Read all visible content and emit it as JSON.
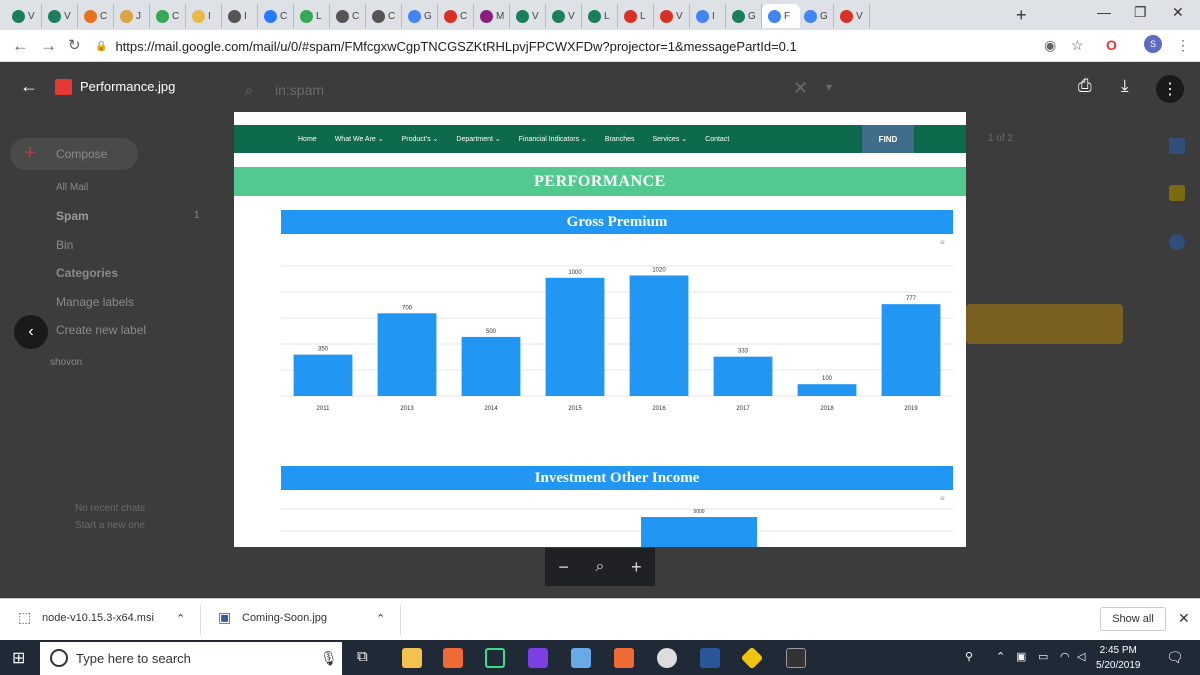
{
  "browser": {
    "tabs": [
      {
        "label": "V"
      },
      {
        "label": "V"
      },
      {
        "label": "C"
      },
      {
        "label": "J"
      },
      {
        "label": "C"
      },
      {
        "label": "I"
      },
      {
        "label": "I"
      },
      {
        "label": "C"
      },
      {
        "label": "L"
      },
      {
        "label": "C"
      },
      {
        "label": "C"
      },
      {
        "label": "G"
      },
      {
        "label": "C"
      },
      {
        "label": "M"
      },
      {
        "label": "V"
      },
      {
        "label": "V"
      },
      {
        "label": "L"
      },
      {
        "label": "L"
      },
      {
        "label": "V"
      },
      {
        "label": "I"
      },
      {
        "label": "G"
      },
      {
        "label": "F"
      },
      {
        "label": "G"
      },
      {
        "label": "V"
      }
    ],
    "active_tab_label": "F",
    "url": "https://mail.google.com/mail/u/0/#spam/FMfcgxwCgpTNCGSZKtRHLpvjFPCWXFDw?projector=1&messagePartId=0.1",
    "profile_initial": "S"
  },
  "gmail": {
    "search_value": "in:spam",
    "compose_label": "Compose",
    "all_mail_label": "All Mail",
    "spam_label": "Spam",
    "spam_count": "1",
    "bin_label": "Bin",
    "categories_label": "Categories",
    "manage_labels": "Manage labels",
    "create_label": "Create new label",
    "user_name": "shovon",
    "no_chats": "No recent chats",
    "start_chat": "Start a new one",
    "pagination": "1 of 2"
  },
  "viewer": {
    "filename": "Performance.jpg"
  },
  "site": {
    "nav": [
      "Home",
      "What We Are ⌄",
      "Product's ⌄",
      "Department ⌄",
      "Financial Indicators ⌄",
      "Branches",
      "Services ⌄",
      "Contact"
    ],
    "find_label": "FIND",
    "section_title": "PERFORMANCE"
  },
  "chart_data": [
    {
      "type": "bar",
      "title": "Gross Premium",
      "categories": [
        "2011",
        "2013",
        "2014",
        "2015",
        "2016",
        "2017",
        "2018",
        "2019"
      ],
      "values": [
        350,
        700,
        500,
        1000,
        1020,
        333,
        100,
        777
      ],
      "ylim": [
        0,
        1100
      ],
      "grid": true,
      "color": "#2196f3"
    },
    {
      "type": "bar",
      "title": "Investment Other Income",
      "categories": [],
      "values": [
        5000
      ],
      "visible_labels": [
        "5000"
      ],
      "color": "#2196f3"
    }
  ],
  "downloads": {
    "items": [
      {
        "name": "node-v10.15.3-x64.msi"
      },
      {
        "name": "Coming-Soon.jpg"
      }
    ],
    "show_all": "Show all"
  },
  "taskbar": {
    "search_placeholder": "Type here to search",
    "time": "2:45 PM",
    "date": "5/20/2019"
  }
}
